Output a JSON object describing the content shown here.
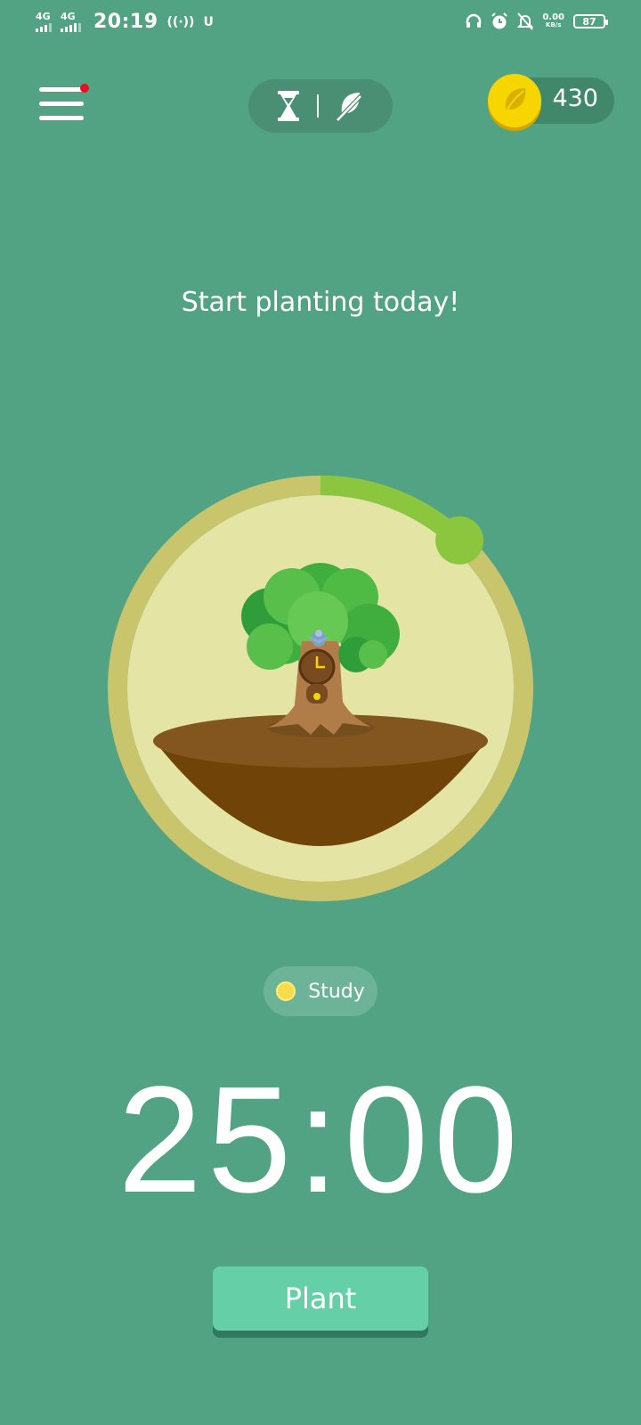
{
  "status_bar": {
    "network_1": "4G",
    "network_2": "4G",
    "time": "20:19",
    "icon_u": "U",
    "speed_value": "0.00",
    "speed_unit": "KB/s",
    "battery": "87"
  },
  "header": {
    "menu_icon": "hamburger-menu-icon",
    "mode_timer_icon": "hourglass-icon",
    "mode_focus_icon": "no-phone-leaf-icon",
    "coin_icon": "gold-coin-icon",
    "coins": "430"
  },
  "main": {
    "headline": "Start planting today!",
    "tag_label": "Study",
    "tag_color": "#f7dc4a",
    "timer": "25:00",
    "plant_button": "Plant",
    "progress_fraction": 0.12
  },
  "colors": {
    "background": "#52a384",
    "accent": "#8cc63f",
    "button": "#65cfa8",
    "coin": "#f7d600"
  }
}
